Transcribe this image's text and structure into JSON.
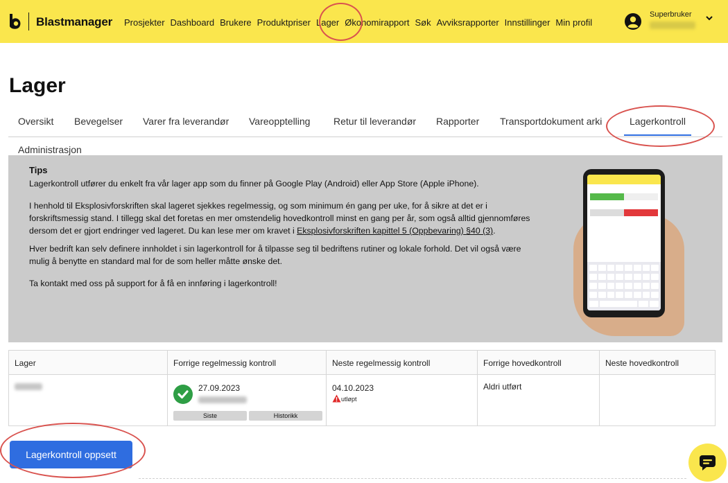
{
  "header": {
    "brand": "Blastmanager",
    "nav": [
      "Prosjekter",
      "Dashboard",
      "Brukere",
      "Produktpriser",
      "Lager",
      "Økonomirapport",
      "Søk",
      "Avviksrapporter",
      "Innstillinger",
      "Min profil"
    ],
    "user_role": "Superbruker",
    "accent_color": "#fae64d"
  },
  "page": {
    "title": "Lager"
  },
  "tabs": [
    "Oversikt",
    "Bevegelser",
    "Varer fra leverandør",
    "Vareopptelling",
    "Retur til leverandør",
    "Rapporter",
    "Transportdokument arki",
    "Lagerkontroll"
  ],
  "tabs_second_row": [
    "Administrasjon"
  ],
  "active_tab": "Lagerkontroll",
  "tips": {
    "title": "Tips",
    "p1": "Lagerkontroll utfører du enkelt fra vår lager app som du finner på Google Play (Android) eller App Store (Apple iPhone).",
    "p2a": "I henhold til Eksplosivforskriften skal lageret sjekkes regelmessig, og som minimum én gang per uke, for å sikre at det er i",
    "p2b": "forskriftsmessig stand. I tillegg skal det foretas en mer omstendelig hovedkontroll minst en gang per år, som også alltid gjennomføres",
    "p2c": "dersom det er gjort endringer ved lageret. Du kan lese mer om kravet i ",
    "p2_link": "Eksplosivforskriften kapittel 5 (Oppbevaring) §40 (3)",
    "p2_end": ".",
    "p3a": "Hver bedrift kan selv definere innholdet i sin lagerkontroll for å tilpasse seg til bedriftens rutiner og lokale forhold. Det vil også være",
    "p3b": "mulig å benytte en standard mal for de som heller måtte ønske det.",
    "p4": "Ta kontakt med oss på support for å få en innføring i lagerkontroll!"
  },
  "table": {
    "headers": [
      "Lager",
      "Forrige regelmessig kontroll",
      "Neste regelmessig kontroll",
      "Forrige hovedkontroll",
      "Neste hovedkontroll"
    ],
    "rows": [
      {
        "prev_regular_date": "27.09.2023",
        "btn_last": "Siste",
        "btn_history": "Historikk",
        "next_regular_date": "04.10.2023",
        "next_regular_status": "utløpt",
        "prev_main": "Aldri utført",
        "next_main": ""
      }
    ]
  },
  "actions": {
    "setup_button": "Lagerkontroll oppsett"
  }
}
